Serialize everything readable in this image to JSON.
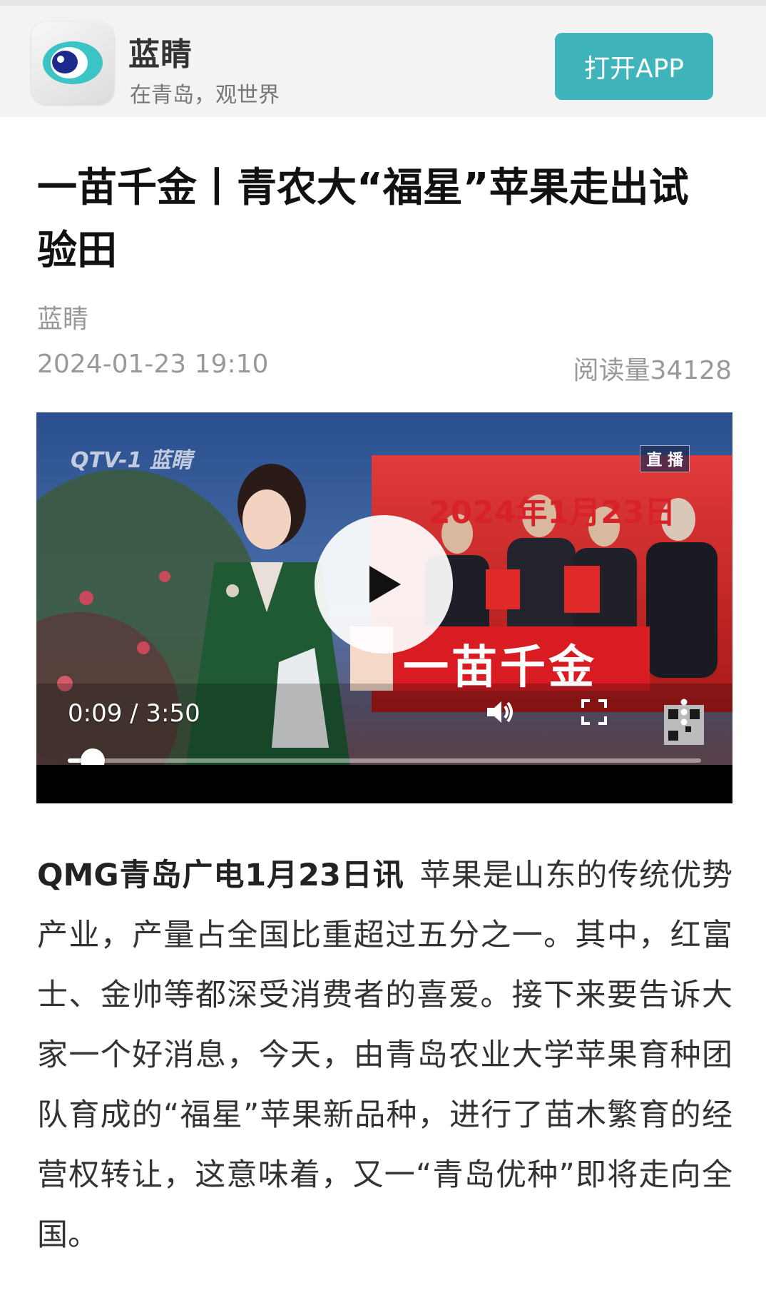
{
  "banner": {
    "app_name": "蓝睛",
    "slogan": "在青岛，观世界",
    "open_app_label": "打开APP"
  },
  "article": {
    "title": "一苗千金丨青农大“福星”苹果走出试验田",
    "source": "蓝睛",
    "date": "2024-01-23 19:10",
    "reads": "阅读量34128",
    "lead": "QMG青岛广电1月23日讯",
    "body": "苹果是山东的传统优势产业，产量占全国比重超过五分之一。其中，红富士、金帅等都深受消费者的喜爱。接下来要告诉大家一个好消息，今天，由青岛农业大学苹果育种团队育成的“福星”苹果新品种，进行了苗木繁育的经营权转让，这意味着，又一“青岛优种”即将走向全国。"
  },
  "video": {
    "channel_logo": "QTV-1 蓝睛",
    "live_badge": "直 播",
    "banner_date": "2024年1月23日",
    "headline": "一苗千金",
    "current_time": "0:09",
    "duration": "3:50",
    "time_readout": "0:09 / 3:50",
    "progress_fraction": 0.039,
    "icons": [
      "play-icon",
      "volume-icon",
      "fullscreen-icon",
      "more-icon"
    ]
  },
  "colors": {
    "accent": "#3fb5bb",
    "muted_text": "#999999",
    "title_text": "#111111"
  }
}
